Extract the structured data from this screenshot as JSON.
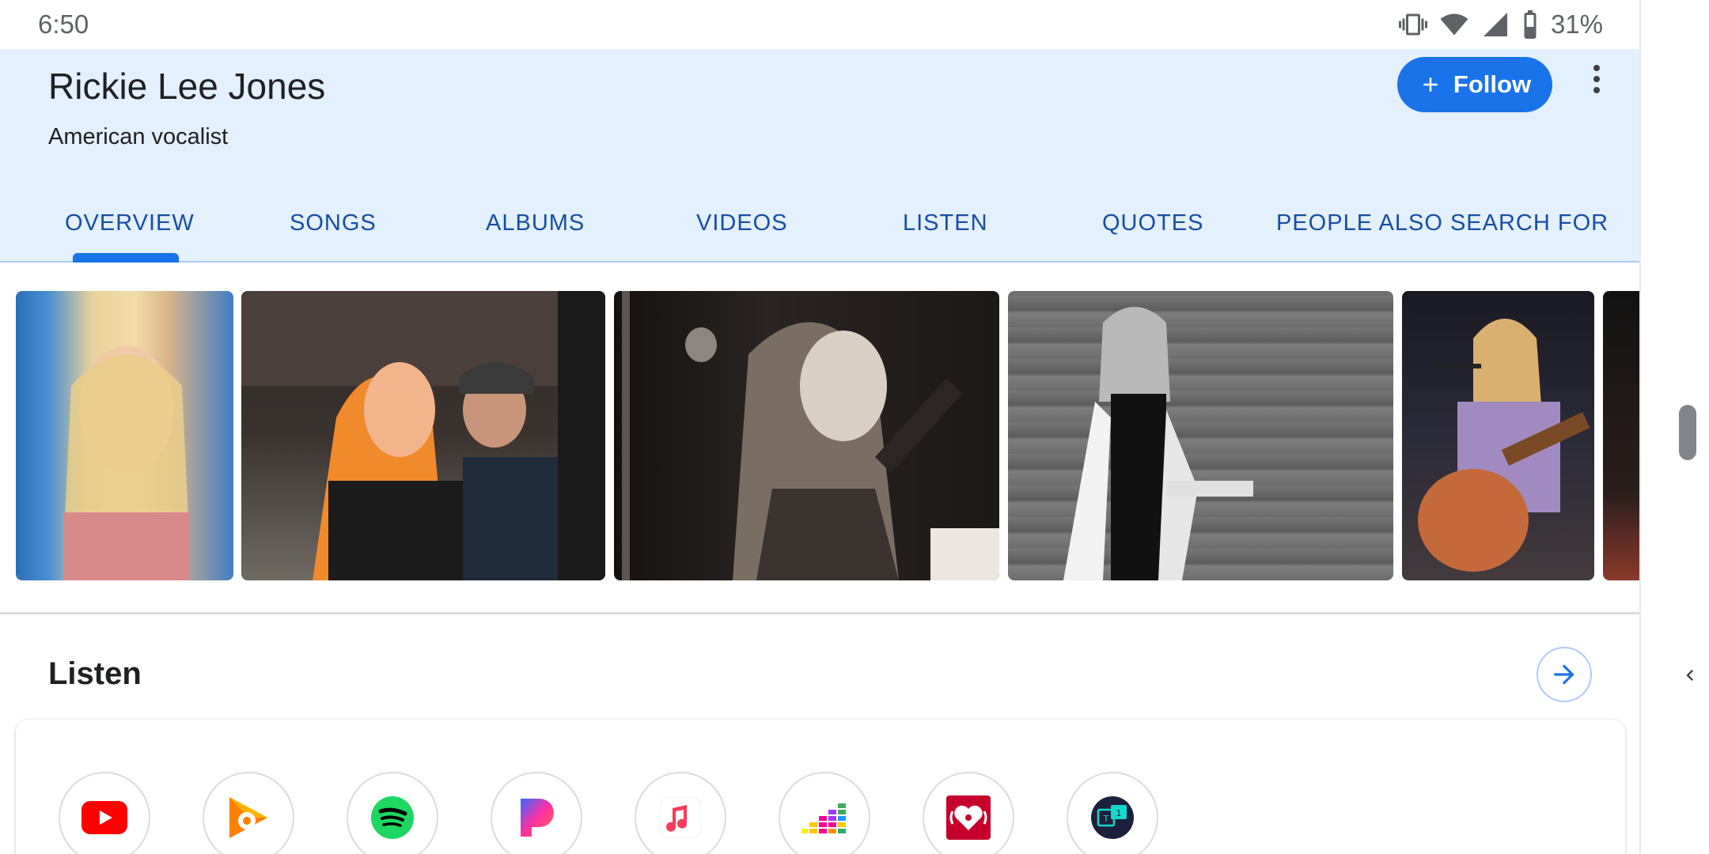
{
  "status_bar": {
    "time": "6:50",
    "battery_pct": "31%",
    "icons": [
      "vibrate-icon",
      "wifi-icon",
      "signal-icon",
      "battery-icon"
    ]
  },
  "entity": {
    "title": "Rickie Lee Jones",
    "subtitle": "American vocalist",
    "follow_label": "Follow"
  },
  "tabs": [
    {
      "label": "OVERVIEW",
      "selected": true
    },
    {
      "label": "SONGS",
      "selected": false
    },
    {
      "label": "ALBUMS",
      "selected": false
    },
    {
      "label": "VIDEOS",
      "selected": false
    },
    {
      "label": "LISTEN",
      "selected": false
    },
    {
      "label": "QUOTES",
      "selected": false
    },
    {
      "label": "PEOPLE ALSO SEARCH FOR",
      "selected": false
    }
  ],
  "gallery": {
    "photo_count_visible": 6
  },
  "listen": {
    "title": "Listen",
    "providers": [
      "youtube-icon",
      "google-play-music-icon",
      "spotify-icon",
      "pandora-icon",
      "apple-music-icon",
      "deezer-icon",
      "iheartradio-icon",
      "tunein-icon"
    ]
  },
  "colors": {
    "accent": "#1a73e8",
    "header_bg": "#e3f0fd",
    "tab_text": "#174ea6"
  }
}
